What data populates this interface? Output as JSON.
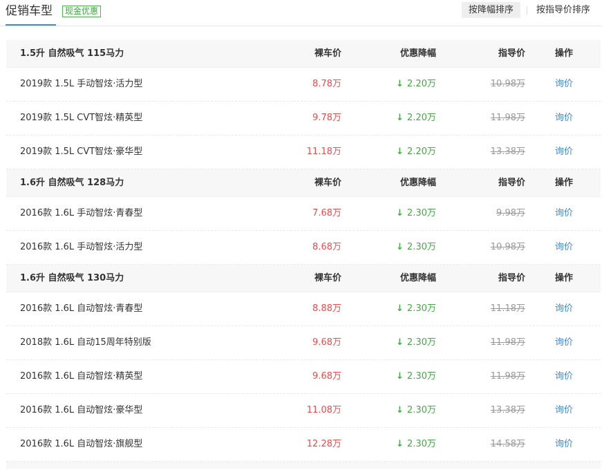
{
  "header": {
    "title": "促销车型",
    "badge": "现金优惠",
    "sort_by_discount": "按降幅排序",
    "sort_by_guide_price": "按指导价排序"
  },
  "columns": {
    "bare_price": "裸车价",
    "discount": "优惠降幅",
    "guide_price": "指导价",
    "action": "操作"
  },
  "groups": [
    {
      "title": "1.5升 自然吸气 115马力",
      "rows": [
        {
          "name": "2019款 1.5L 手动智炫·活力型",
          "price": "8.78万",
          "discount": "2.20万",
          "guide": "10.98万",
          "action": "询价"
        },
        {
          "name": "2019款 1.5L CVT智炫·精英型",
          "price": "9.78万",
          "discount": "2.20万",
          "guide": "11.98万",
          "action": "询价"
        },
        {
          "name": "2019款 1.5L CVT智炫·豪华型",
          "price": "11.18万",
          "discount": "2.20万",
          "guide": "13.38万",
          "action": "询价"
        }
      ]
    },
    {
      "title": "1.6升 自然吸气 128马力",
      "rows": [
        {
          "name": "2016款 1.6L 手动智炫·青春型",
          "price": "7.68万",
          "discount": "2.30万",
          "guide": "9.98万",
          "action": "询价"
        },
        {
          "name": "2016款 1.6L 手动智炫·活力型",
          "price": "8.68万",
          "discount": "2.30万",
          "guide": "10.98万",
          "action": "询价"
        }
      ]
    },
    {
      "title": "1.6升 自然吸气 130马力",
      "rows": [
        {
          "name": "2016款 1.6L 自动智炫·青春型",
          "price": "8.88万",
          "discount": "2.30万",
          "guide": "11.18万",
          "action": "询价"
        },
        {
          "name": "2018款 1.6L 自动15周年特别版",
          "price": "9.68万",
          "discount": "2.30万",
          "guide": "11.98万",
          "action": "询价"
        },
        {
          "name": "2016款 1.6L 自动智炫·精英型",
          "price": "9.68万",
          "discount": "2.30万",
          "guide": "11.98万",
          "action": "询价"
        },
        {
          "name": "2016款 1.6L 自动智炫·豪华型",
          "price": "11.08万",
          "discount": "2.30万",
          "guide": "13.38万",
          "action": "询价"
        },
        {
          "name": "2016款 1.6L 自动智炫·旗舰型",
          "price": "12.28万",
          "discount": "2.30万",
          "guide": "14.58万",
          "action": "询价"
        }
      ]
    }
  ],
  "icons": {
    "discount_arrow": "down-arrow-icon"
  },
  "colors": {
    "accent": "#3d88d8",
    "price": "#ef4a4a",
    "discount": "#44a845",
    "muted": "#999999"
  }
}
